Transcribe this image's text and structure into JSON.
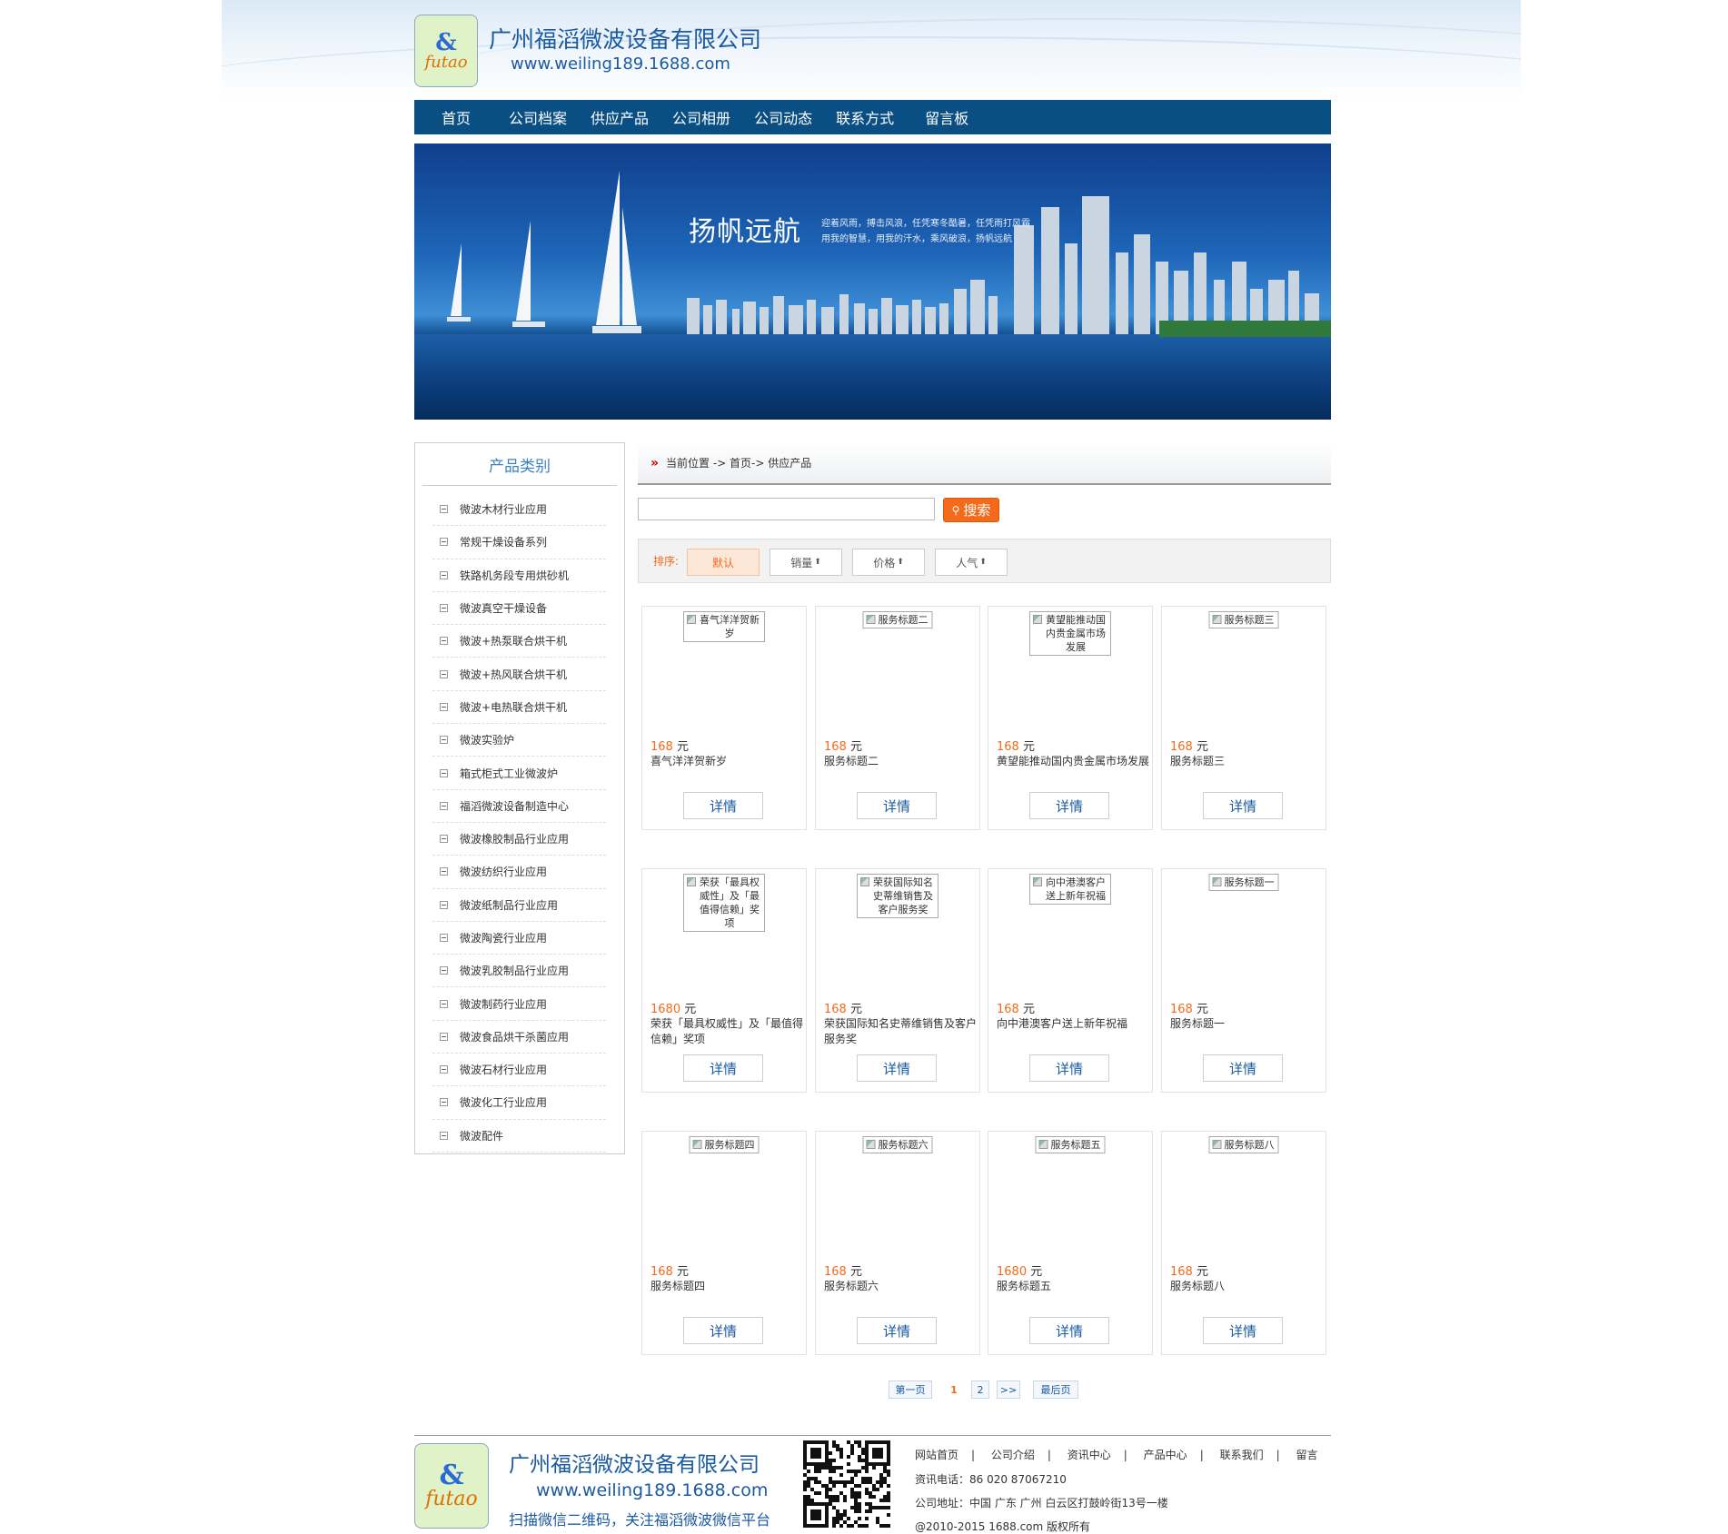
{
  "header": {
    "logo_mark": "&",
    "logo_word": "futao",
    "company": "广州福滔微波设备有限公司",
    "url": "www.weiling189.1688.com"
  },
  "nav": [
    "首页",
    "公司档案",
    "供应产品",
    "公司相册",
    "公司动态",
    "联系方式",
    "留言板"
  ],
  "banner": {
    "title": "扬帆远航",
    "sub_line1": "迎着风雨，搏击风浪，任凭寒冬酷暑，任凭雨打风霜",
    "sub_line2": "用我的智慧，用我的汗水，乘风破浪，扬帆远航"
  },
  "sidebar": {
    "title": "产品类别",
    "items": [
      "微波木材行业应用",
      "常规干燥设备系列",
      "铁路机务段专用烘砂机",
      "微波真空干燥设备",
      "微波+热泵联合烘干机",
      "微波+热风联合烘干机",
      "微波+电热联合烘干机",
      "微波实验炉",
      "箱式柜式工业微波炉",
      "福滔微波设备制造中心",
      "微波橡胶制品行业应用",
      "微波纺织行业应用",
      "微波纸制品行业应用",
      "微波陶瓷行业应用",
      "微波乳胶制品行业应用",
      "微波制药行业应用",
      "微波食品烘干杀菌应用",
      "微波石材行业应用",
      "微波化工行业应用",
      "微波配件"
    ]
  },
  "breadcrumb": "当前位置 -> 首页-> 供应产品",
  "search": {
    "button": "搜索",
    "icon": "search-icon"
  },
  "sort": {
    "label": "排序:",
    "options": [
      "默认",
      "销量",
      "价格",
      "人气"
    ]
  },
  "currency": "元",
  "detail_label": "详情",
  "products": [
    {
      "alt": "喜气洋洋贺新岁",
      "price": "168",
      "name": "喜气洋洋贺新岁"
    },
    {
      "alt": "服务标题二",
      "price": "168",
      "name": "服务标题二"
    },
    {
      "alt": "黄望能推动国内贵金属市场发展",
      "price": "168",
      "name": "黄望能推动国内贵金属市场发展"
    },
    {
      "alt": "服务标题三",
      "price": "168",
      "name": "服务标题三"
    },
    {
      "alt": "荣获「最具权威性」及「最值得信赖」奖项",
      "price": "1680",
      "name": "荣获「最具权威性」及「最值得信赖」奖项"
    },
    {
      "alt": "荣获国际知名史蒂维销售及客户服务奖",
      "price": "168",
      "name": "荣获国际知名史蒂维销售及客户服务奖"
    },
    {
      "alt": "向中港澳客户送上新年祝福",
      "price": "168",
      "name": "向中港澳客户送上新年祝福"
    },
    {
      "alt": "服务标题一",
      "price": "168",
      "name": "服务标题一"
    },
    {
      "alt": "服务标题四",
      "price": "168",
      "name": "服务标题四"
    },
    {
      "alt": "服务标题六",
      "price": "168",
      "name": "服务标题六"
    },
    {
      "alt": "服务标题五",
      "price": "1680",
      "name": "服务标题五"
    },
    {
      "alt": "服务标题八",
      "price": "168",
      "name": "服务标题八"
    }
  ],
  "pager": {
    "first": "第一页",
    "pages": [
      "1",
      "2"
    ],
    "next": ">>",
    "last": "最后页"
  },
  "footer": {
    "company": "广州福滔微波设备有限公司",
    "url": "www.weiling189.1688.com",
    "slogan": "扫描微信二维码，关注福滔微波微信平台",
    "links": [
      "网站首页",
      "公司介绍",
      "资讯中心",
      "产品中心",
      "联系我们",
      "留言"
    ],
    "phone": "资讯电话：86 020 87067210",
    "address": "公司地址：中国 广东 广州 白云区打鼓岭街13号一楼",
    "copyright": "@2010-2015 1688.com 版权所有"
  },
  "colors": {
    "nav_bg": "#0a4f84",
    "accent": "#f46a1a",
    "link": "#1a5aa0"
  }
}
